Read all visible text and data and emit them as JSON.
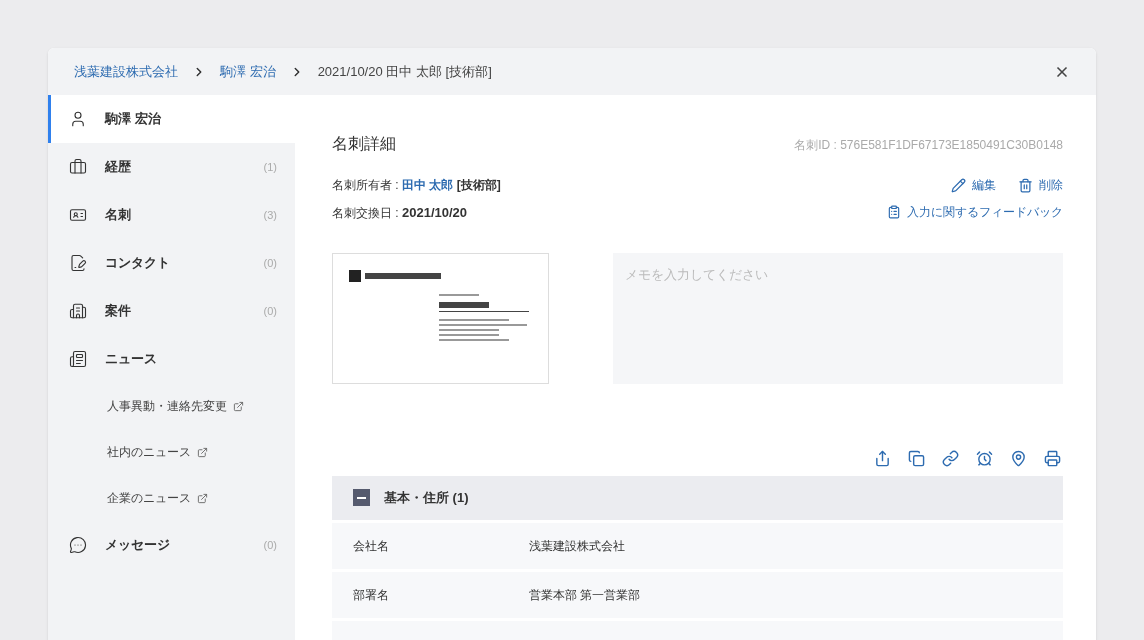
{
  "breadcrumb": [
    {
      "label": "浅葉建設株式会社",
      "kind": "link"
    },
    {
      "label": "駒澤 宏治",
      "kind": "link"
    },
    {
      "label": "2021/10/20 田中 太郎 [技術部]",
      "kind": "current"
    }
  ],
  "sidebar": {
    "items": [
      {
        "label": "駒澤 宏治",
        "selected": true
      },
      {
        "label": "経歴",
        "count": "(1)",
        "selected": false
      },
      {
        "label": "名刺",
        "count": "(3)",
        "selected": false
      },
      {
        "label": "コンタクト",
        "count": "(0)",
        "selected": false
      },
      {
        "label": "案件",
        "count": "(0)",
        "selected": false
      },
      {
        "label": "ニュース",
        "selected": false,
        "children": [
          {
            "label": "人事異動・連絡先変更"
          },
          {
            "label": "社内のニュース"
          },
          {
            "label": "企業のニュース"
          }
        ]
      },
      {
        "label": "メッセージ",
        "count": "(0)",
        "selected": false
      }
    ]
  },
  "detail": {
    "title": "名刺詳細",
    "card_id": "名刺ID : 576E581F1DF67173E1850491C30B0148",
    "owner": {
      "label": "名刺所有者 : ",
      "name": "田中 太郎",
      "dept": "[技術部]"
    },
    "exchange_date": {
      "label": "名刺交換日 : ",
      "value": "2021/10/20"
    },
    "actions": [
      {
        "label": "編集"
      },
      {
        "label": "削除"
      }
    ],
    "feedback": "入力に関するフィードバック",
    "memo": {
      "placeholder": "メモを入力してください"
    },
    "section": {
      "title": "基本・住所 (1)",
      "expanded": true,
      "rows": [
        {
          "label": "会社名",
          "value": "浅葉建設株式会社"
        },
        {
          "label": "部署名",
          "value": "営業本部 第一営業部"
        }
      ]
    }
  }
}
